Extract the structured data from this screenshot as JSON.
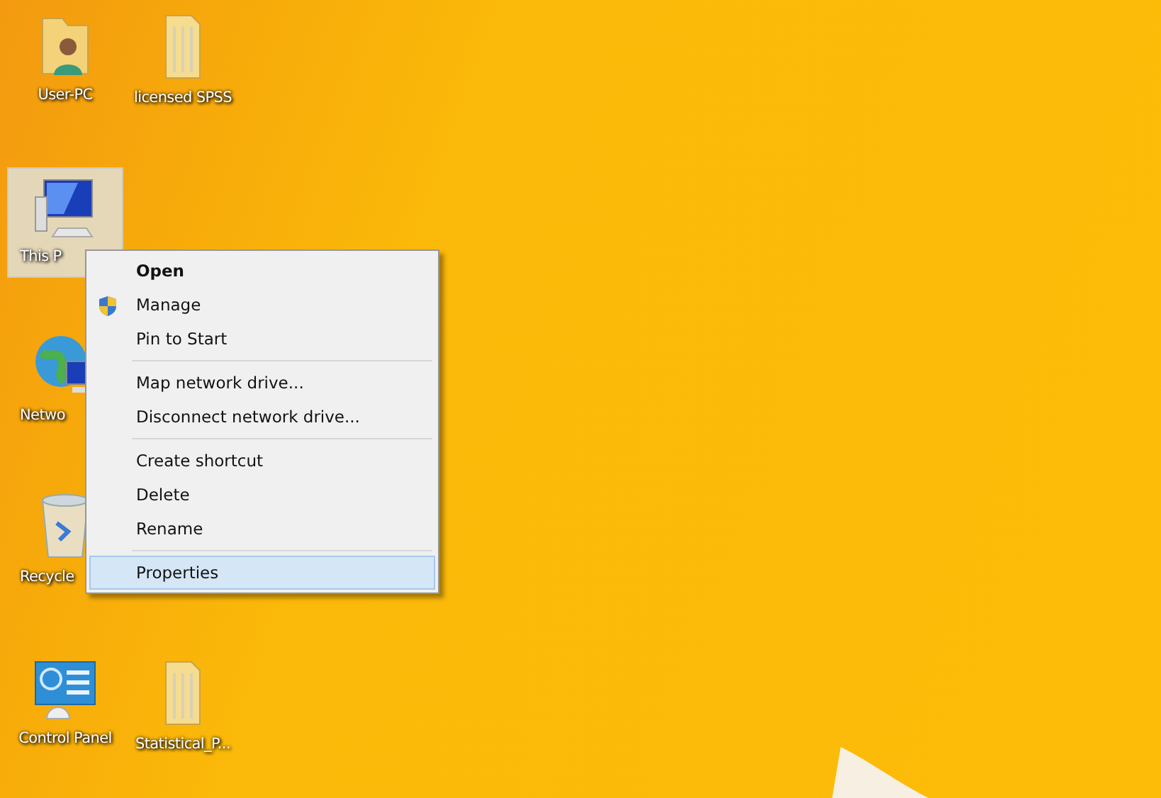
{
  "desktop_icons": [
    {
      "label": "User-PC",
      "kind": "user-folder",
      "selected": false
    },
    {
      "label": "licensed SPSS",
      "kind": "folder",
      "selected": false
    },
    {
      "label": "This P",
      "kind": "computer",
      "selected": true
    },
    {
      "label": "Netwo",
      "kind": "network",
      "selected": false
    },
    {
      "label": "Recycle",
      "kind": "recycle-bin",
      "selected": false
    },
    {
      "label": "Control Panel",
      "kind": "control-panel",
      "selected": false
    },
    {
      "label": "Statistical_P...",
      "kind": "folder",
      "selected": false
    }
  ],
  "context_menu": {
    "groups": [
      [
        {
          "label": "Open",
          "default": true,
          "elevated": false,
          "selected": false
        },
        {
          "label": "Manage",
          "default": false,
          "elevated": true,
          "selected": false
        },
        {
          "label": "Pin to Start",
          "default": false,
          "elevated": false,
          "selected": false
        }
      ],
      [
        {
          "label": "Map network drive...",
          "default": false,
          "elevated": false,
          "selected": false
        },
        {
          "label": "Disconnect network drive...",
          "default": false,
          "elevated": false,
          "selected": false
        }
      ],
      [
        {
          "label": "Create shortcut",
          "default": false,
          "elevated": false,
          "selected": false
        },
        {
          "label": "Delete",
          "default": false,
          "elevated": false,
          "selected": false
        },
        {
          "label": "Rename",
          "default": false,
          "elevated": false,
          "selected": false
        }
      ],
      [
        {
          "label": "Properties",
          "default": false,
          "elevated": false,
          "selected": true
        }
      ]
    ]
  }
}
